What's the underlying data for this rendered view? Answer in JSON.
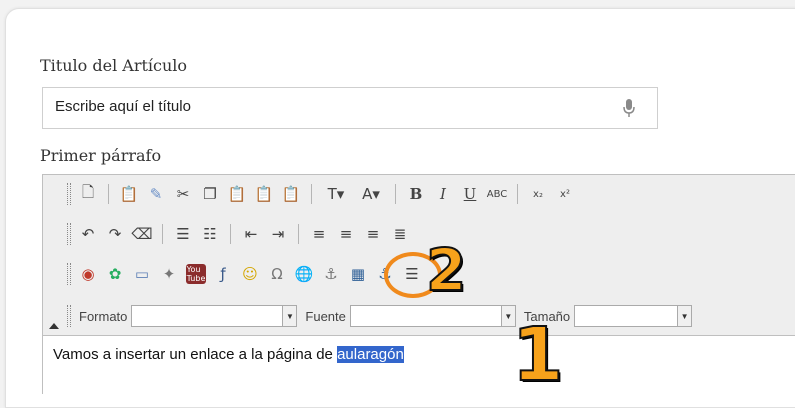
{
  "title_field": {
    "label": "Titulo del Artículo",
    "placeholder": "Escribe aquí el título"
  },
  "paragraph": {
    "label": "Primer párrafo"
  },
  "toolbar": {
    "row1": [
      "new-page-icon",
      "paste-text-icon",
      "paste-word-icon",
      "cut-icon",
      "copy-icon",
      "paste-icon",
      "paste-plain-icon",
      "paste-from-word-icon",
      "text-color-icon",
      "bg-color-icon",
      "bold-icon",
      "italic-icon",
      "underline-icon",
      "strike-icon",
      "subscript-icon",
      "superscript-icon"
    ],
    "row1_text": {
      "bold": "B",
      "italic": "I",
      "underline": "U",
      "strike": "ABC",
      "subscript": "x₂",
      "superscript": "x²"
    },
    "row2": [
      "undo-icon",
      "redo-icon",
      "remove-format-icon",
      "numbered-list-icon",
      "bulleted-list-icon",
      "outdent-icon",
      "indent-icon",
      "align-left-icon",
      "align-center-icon",
      "align-right-icon",
      "justify-icon"
    ],
    "row3": [
      "map-icon",
      "media-icon",
      "image-icon",
      "gallery-icon",
      "youtube-icon",
      "flash-icon",
      "smiley-icon",
      "special-char-icon",
      "link-globe-icon",
      "unlink-icon",
      "table-icon",
      "anchor-icon",
      "horizontal-rule-icon"
    ],
    "youtube_label": "You\nTube",
    "combos": {
      "format_label": "Formato",
      "font_label": "Fuente",
      "size_label": "Tamaño"
    }
  },
  "editor_content": {
    "text_before": "Vamos a insertar un enlace a la página de ",
    "selected_text": "aularagón"
  },
  "callouts": {
    "one": "1",
    "two": "2"
  },
  "colors": {
    "callout_fill": "#f7a21b",
    "selection": "#3366cc",
    "ring": "#f08a1c"
  }
}
